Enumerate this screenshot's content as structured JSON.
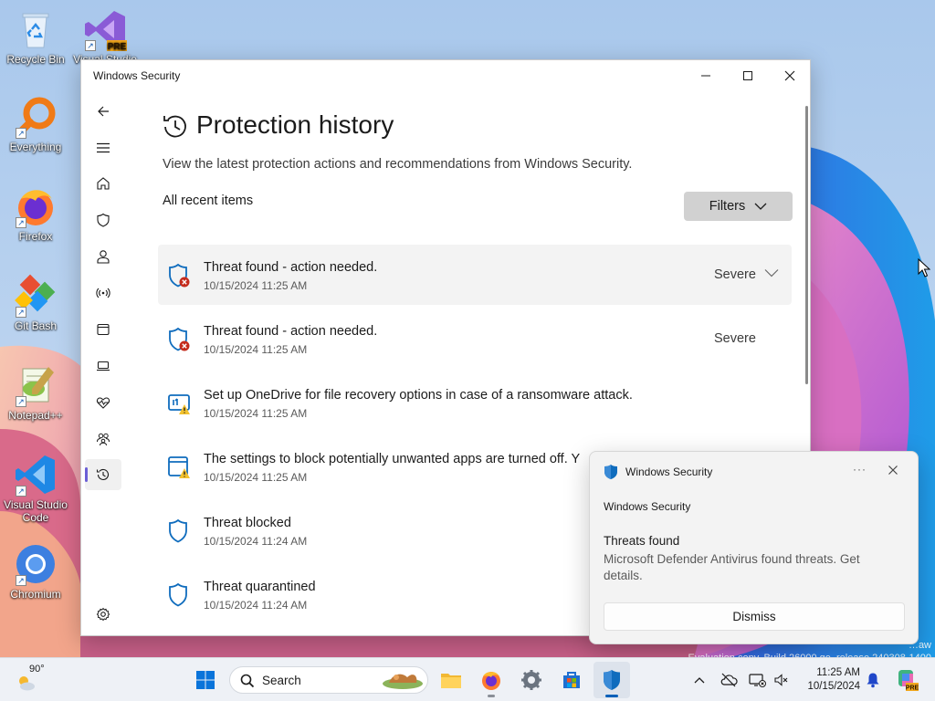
{
  "desktop": {
    "icons": [
      {
        "label": "Recycle Bin",
        "icon": "recycle-bin-icon"
      },
      {
        "label": "Visual Studio 2…",
        "icon": "visual-studio-preview-icon",
        "badge": "PRE"
      },
      {
        "label": "Everything",
        "icon": "everything-search-icon"
      },
      {
        "label": "Firefox",
        "icon": "firefox-icon"
      },
      {
        "label": "Git Bash",
        "icon": "git-bash-icon"
      },
      {
        "label": "Notepad++",
        "icon": "notepad-plus-plus-icon"
      },
      {
        "label": "Visual Studio Code",
        "icon": "vscode-icon"
      },
      {
        "label": "Chromium",
        "icon": "chromium-icon"
      }
    ],
    "watermark_line1": "…aw",
    "watermark_line2": "Evaluation copy. Build 26000.ge_release.240308-1400"
  },
  "window": {
    "title": "Windows Security",
    "page_title": "Protection history",
    "subtitle": "View the latest protection actions and recommendations from Windows Security.",
    "section_label": "All recent items",
    "filters_label": "Filters",
    "nav_items": [
      {
        "name": "back",
        "icon": "back-arrow-icon"
      },
      {
        "name": "menu",
        "icon": "hamburger-menu-icon"
      },
      {
        "name": "home",
        "icon": "home-icon"
      },
      {
        "name": "virus-protection",
        "icon": "shield-icon"
      },
      {
        "name": "account-protection",
        "icon": "person-icon"
      },
      {
        "name": "firewall-network",
        "icon": "wireless-signal-icon"
      },
      {
        "name": "app-browser-control",
        "icon": "browser-window-icon"
      },
      {
        "name": "device-security",
        "icon": "laptop-icon"
      },
      {
        "name": "device-performance",
        "icon": "heart-pulse-icon"
      },
      {
        "name": "family-options",
        "icon": "family-icon"
      },
      {
        "name": "protection-history",
        "icon": "history-clock-icon",
        "active": true
      },
      {
        "name": "settings",
        "icon": "gear-icon"
      }
    ],
    "history": [
      {
        "title": "Threat found - action needed.",
        "time": "10/15/2024 11:25 AM",
        "severity": "Severe",
        "icon": "shield-alert-icon"
      },
      {
        "title": "Threat found - action needed.",
        "time": "10/15/2024 11:25 AM",
        "severity": "Severe",
        "icon": "shield-alert-icon"
      },
      {
        "title": "Set up OneDrive for file recovery options in case of a ransomware attack.",
        "time": "10/15/2024 11:25 AM",
        "severity": "",
        "icon": "recovery-warning-icon"
      },
      {
        "title": "The settings to block potentially unwanted apps are turned off. Y",
        "time": "10/15/2024 11:25 AM",
        "severity": "",
        "icon": "app-warning-icon"
      },
      {
        "title": "Threat blocked",
        "time": "10/15/2024 11:24 AM",
        "severity": "",
        "icon": "shield-icon"
      },
      {
        "title": "Threat quarantined",
        "time": "10/15/2024 11:24 AM",
        "severity": "",
        "icon": "shield-icon"
      }
    ]
  },
  "toast": {
    "app_name": "Windows Security",
    "more": "···",
    "source": "Windows Security",
    "heading": "Threats found",
    "body": "Microsoft Defender Antivirus found threats. Get details.",
    "dismiss_label": "Dismiss"
  },
  "taskbar": {
    "weather_temp": "90°",
    "search_placeholder": "Search",
    "time": "11:25 AM",
    "date": "10/15/2024"
  },
  "colors": {
    "accent": "#005fb8",
    "shield_blue": "#0f6cbd",
    "alert_red": "#c42b1c",
    "warning_yellow": "#f2c12e",
    "nav_indicator": "#6b5fd6"
  }
}
